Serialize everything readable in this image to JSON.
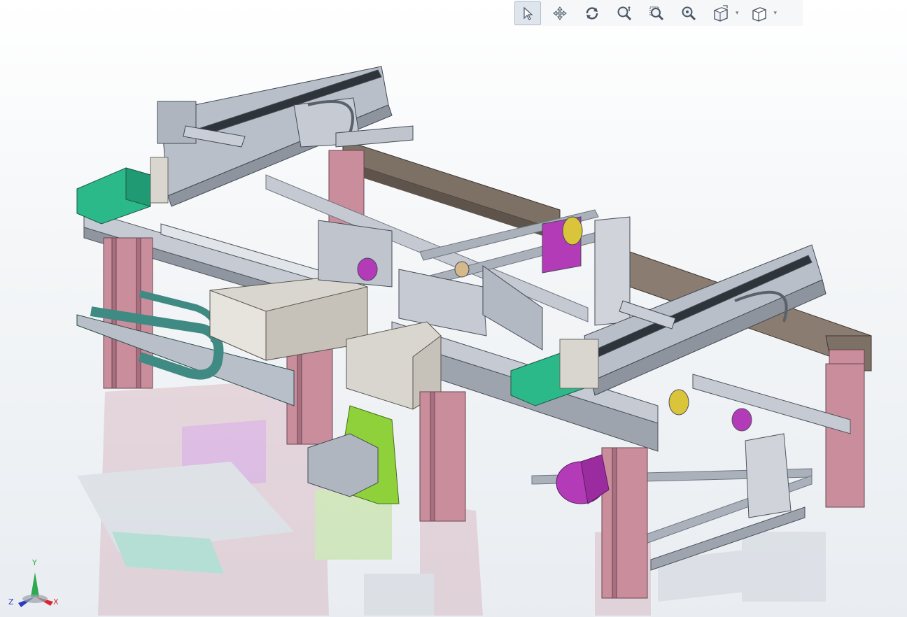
{
  "toolbar": {
    "buttons": [
      {
        "name": "select-icon",
        "active": true
      },
      {
        "name": "pan-icon"
      },
      {
        "name": "rotate-icon"
      },
      {
        "name": "zoom-icon"
      },
      {
        "name": "zoom-area-icon"
      },
      {
        "name": "zoom-fit-icon"
      },
      {
        "name": "view-orientation-icon",
        "dropdown": true
      },
      {
        "name": "display-style-icon",
        "dropdown": true
      }
    ]
  },
  "triad": {
    "x_label": "X",
    "y_label": "Y",
    "z_label": "Z",
    "x_color": "#d8262c",
    "y_color": "#2fa84f",
    "z_color": "#2a3cc0"
  },
  "colors": {
    "frame_gray": "#b9bfc9",
    "profile_pink": "#c98d9c",
    "motor_teal": "#2cb98a",
    "bracket_magenta": "#b33bb8",
    "bracket_lime": "#8ed13a",
    "brown_beam": "#7d7065",
    "motor_beige": "#d9d6cf"
  }
}
